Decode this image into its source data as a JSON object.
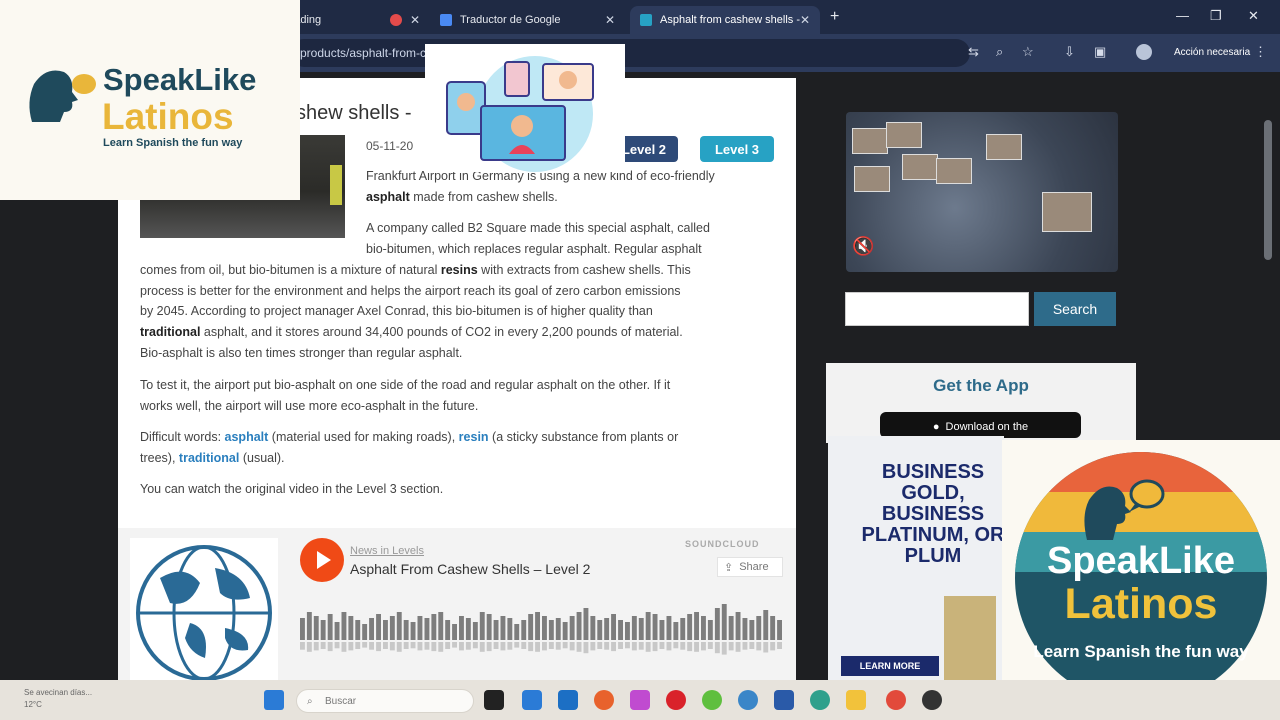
{
  "browser": {
    "tabs": [
      {
        "label": "ón - Loading"
      },
      {
        "label": "Traductor de Google"
      },
      {
        "label": "Asphalt from cashew shells - Ne"
      }
    ],
    "address": "products/asphalt-from-ca",
    "account_button": "Acción necesaria"
  },
  "article": {
    "title_fragment": "shew shells -",
    "date": "05-11-20",
    "levels": [
      {
        "label": "Level 2",
        "color": "#2e4a78"
      },
      {
        "label": "Level 3",
        "color": "#27a2c4"
      }
    ],
    "p1_line1": "Frankfurt Airport in Germany is using a new kind of eco-friendly",
    "p1_bold": "asphalt",
    "p1_line2_rest": "made from cashew shells.",
    "p2_a": "A company called B2 Square made this special asphalt, called",
    "p2_b": "bio-bitumen, which replaces regular asphalt. Regular asphalt",
    "p2_c_pre": "comes from oil, but bio-bitumen is a mixture of natural",
    "p2_c_bold": "resins",
    "p2_c_post": "with extracts from cashew shells. This",
    "p2_d": "process is better for the environment and helps the airport reach its goal of zero carbon emissions",
    "p2_e": "by 2045. According to project manager Axel Conrad, this bio-bitumen is of higher quality than",
    "p2_f_bold": "traditional",
    "p2_f_post": "asphalt, and it stores around 34,400 pounds of CO2 in every 2,200 pounds of material.",
    "p2_g": "Bio-asphalt is also ten times stronger than regular asphalt.",
    "p3_a": "To test it, the airport put bio-asphalt on one side of the road and regular asphalt on the other. If it",
    "p3_b": "works well, the airport will use more eco-asphalt in the future.",
    "dw_label": "Difficult words:",
    "dw1_word": "asphalt",
    "dw1_def": "(material used for making roads),",
    "dw2_word": "resin",
    "dw2_def": "(a sticky substance from plants or",
    "dw2_def2": "trees),",
    "dw3_word": "traditional",
    "dw3_def": "(usual).",
    "video_note": "You can watch the original video in the Level 3 section."
  },
  "player": {
    "author": "News in Levels",
    "track": "Asphalt From Cashew Shells – Level 2",
    "brand": "SOUNDCLOUD",
    "share": "Share",
    "wave_heights": [
      0.55,
      0.7,
      0.6,
      0.5,
      0.65,
      0.45,
      0.7,
      0.6,
      0.5,
      0.4,
      0.55,
      0.65,
      0.5,
      0.6,
      0.7,
      0.5,
      0.45,
      0.6,
      0.55,
      0.65,
      0.7,
      0.5,
      0.4,
      0.6,
      0.55,
      0.45,
      0.7,
      0.65,
      0.5,
      0.6,
      0.55,
      0.4,
      0.5,
      0.65,
      0.7,
      0.6,
      0.5,
      0.55,
      0.45,
      0.6,
      0.7,
      0.8,
      0.6,
      0.5,
      0.55,
      0.65,
      0.5,
      0.45,
      0.6,
      0.55,
      0.7,
      0.65,
      0.5,
      0.6,
      0.45,
      0.55,
      0.65,
      0.7,
      0.6,
      0.5,
      0.8,
      0.9,
      0.6,
      0.7,
      0.55,
      0.5,
      0.6,
      0.75,
      0.6,
      0.5
    ]
  },
  "sidebar": {
    "search_button": "Search",
    "app_title": "Get the App",
    "store_button": "Download on the",
    "ad_text": "BUSINESS GOLD, BUSINESS PLATINUM, OR PLUM",
    "ad_button": "LEARN MORE"
  },
  "overlay": {
    "logo_line1": "SpeakLike",
    "logo_line2": "Latinos",
    "logo_tagline": "Learn Spanish the fun way",
    "badge_line1": "SpeakLike",
    "badge_line2": "Latinos",
    "badge_tagline": "Learn Spanish the fun way"
  },
  "taskbar": {
    "weather_text": "Se avecinan días...",
    "weather_temp": "12°C",
    "search_placeholder": "Buscar"
  }
}
